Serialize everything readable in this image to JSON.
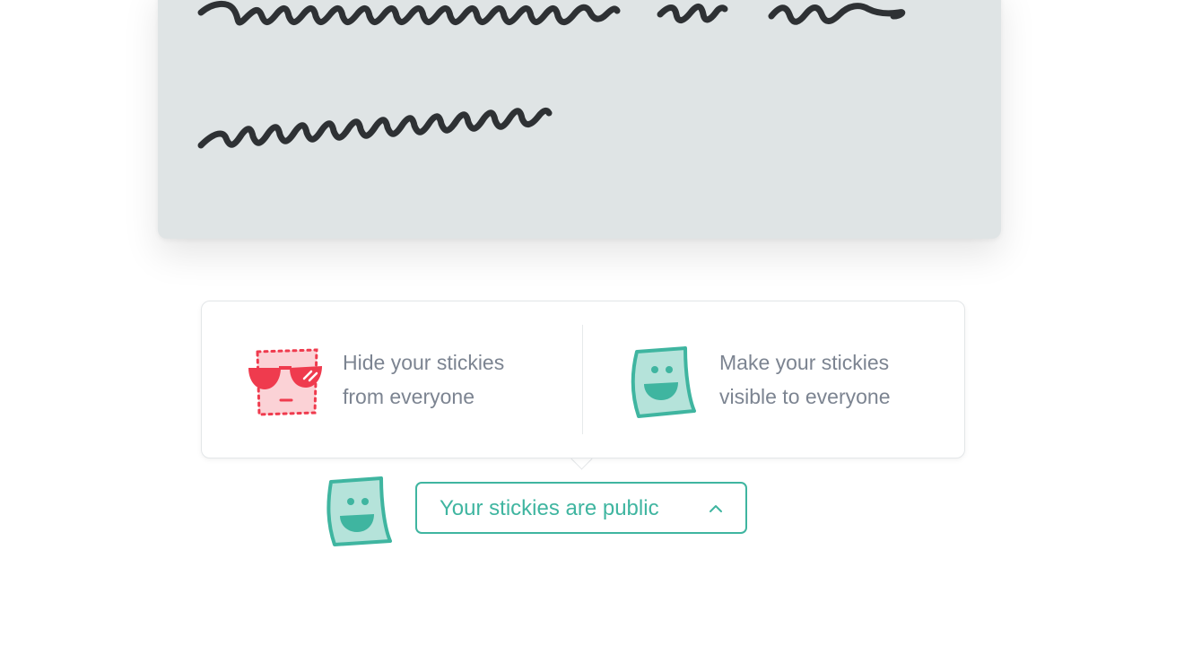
{
  "note": {
    "content": "handwritten-scribble"
  },
  "visibility_menu": {
    "private_option": {
      "icon": "sunglasses-sticky-icon",
      "line1": "Hide your stickies",
      "line2": "from everyone",
      "color": "#ef3b4e"
    },
    "public_option": {
      "icon": "smiling-sticky-icon",
      "line1": "Make your stickies",
      "line2": "visible to everyone",
      "color": "#3fb5a0"
    }
  },
  "status": {
    "icon": "smiling-sticky-icon",
    "label": "Your stickies are public",
    "chevron_icon": "chevron-up-icon",
    "accent": "#3fb5a0"
  }
}
